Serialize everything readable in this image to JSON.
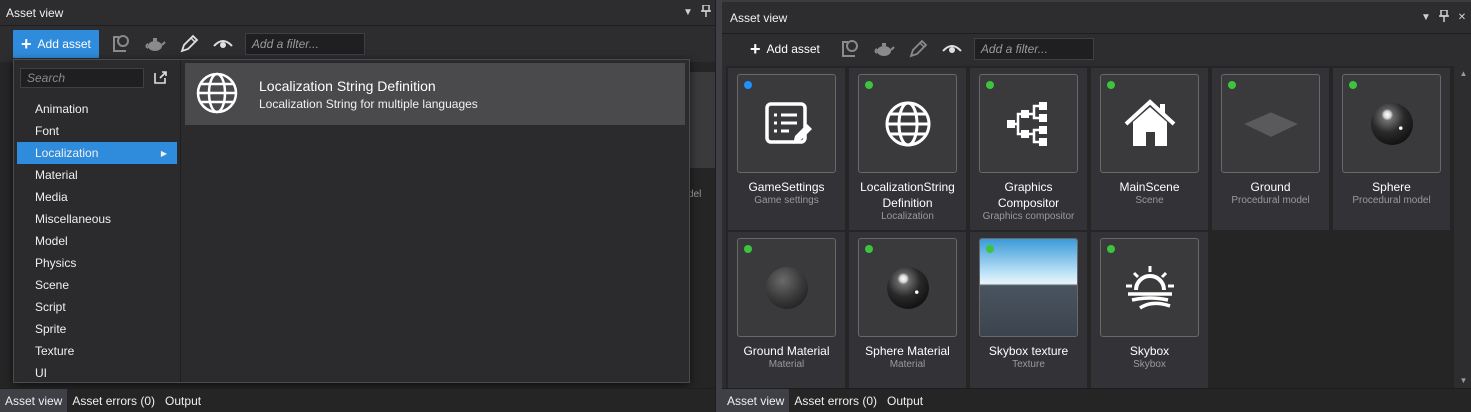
{
  "left_panel": {
    "title": "Asset view",
    "add_asset_label": "Add asset",
    "filter_placeholder": "Add a filter...",
    "bg_partial_text": "del",
    "dropdown": {
      "search_placeholder": "Search",
      "categories": [
        "Animation",
        "Font",
        "Localization",
        "Material",
        "Media",
        "Miscellaneous",
        "Model",
        "Physics",
        "Scene",
        "Script",
        "Sprite",
        "Texture",
        "UI"
      ],
      "selected_category": "Localization",
      "templates": [
        {
          "title": "Localization String Definition",
          "description": "Localization String for multiple languages",
          "icon": "globe-icon"
        }
      ]
    },
    "footer_tabs": [
      "Asset view",
      "Asset errors (0)",
      "Output"
    ]
  },
  "right_panel": {
    "title": "Asset view",
    "add_asset_label": "Add asset",
    "filter_placeholder": "Add a filter...",
    "assets": [
      {
        "name": "GameSettings",
        "type": "Game settings",
        "icon": "settings-doc-icon",
        "status": "blue"
      },
      {
        "name": "LocalizationString Definition",
        "type": "Localization",
        "icon": "globe-icon",
        "status": "green"
      },
      {
        "name": "Graphics Compositor",
        "type": "Graphics compositor",
        "icon": "compositor-icon",
        "status": "green"
      },
      {
        "name": "MainScene",
        "type": "Scene",
        "icon": "house-icon",
        "status": "green"
      },
      {
        "name": "Ground",
        "type": "Procedural model",
        "icon": "plane-thumb",
        "status": "green"
      },
      {
        "name": "Sphere",
        "type": "Procedural model",
        "icon": "sphere-shiny-thumb",
        "status": "green"
      },
      {
        "name": "Ground Material",
        "type": "Material",
        "icon": "sphere-matte-thumb",
        "status": "green"
      },
      {
        "name": "Sphere Material",
        "type": "Material",
        "icon": "sphere-shiny-thumb",
        "status": "green"
      },
      {
        "name": "Skybox texture",
        "type": "Texture",
        "icon": "sky-thumb",
        "status": "green"
      },
      {
        "name": "Skybox",
        "type": "Skybox",
        "icon": "sunrise-icon",
        "status": "green"
      }
    ],
    "footer_tabs": [
      "Asset view",
      "Asset errors (0)",
      "Output"
    ]
  },
  "colors": {
    "accent": "#2f8bdc",
    "status_green": "#3cc43c",
    "status_blue": "#1e90ff",
    "panel_bg": "#2d2d30"
  }
}
